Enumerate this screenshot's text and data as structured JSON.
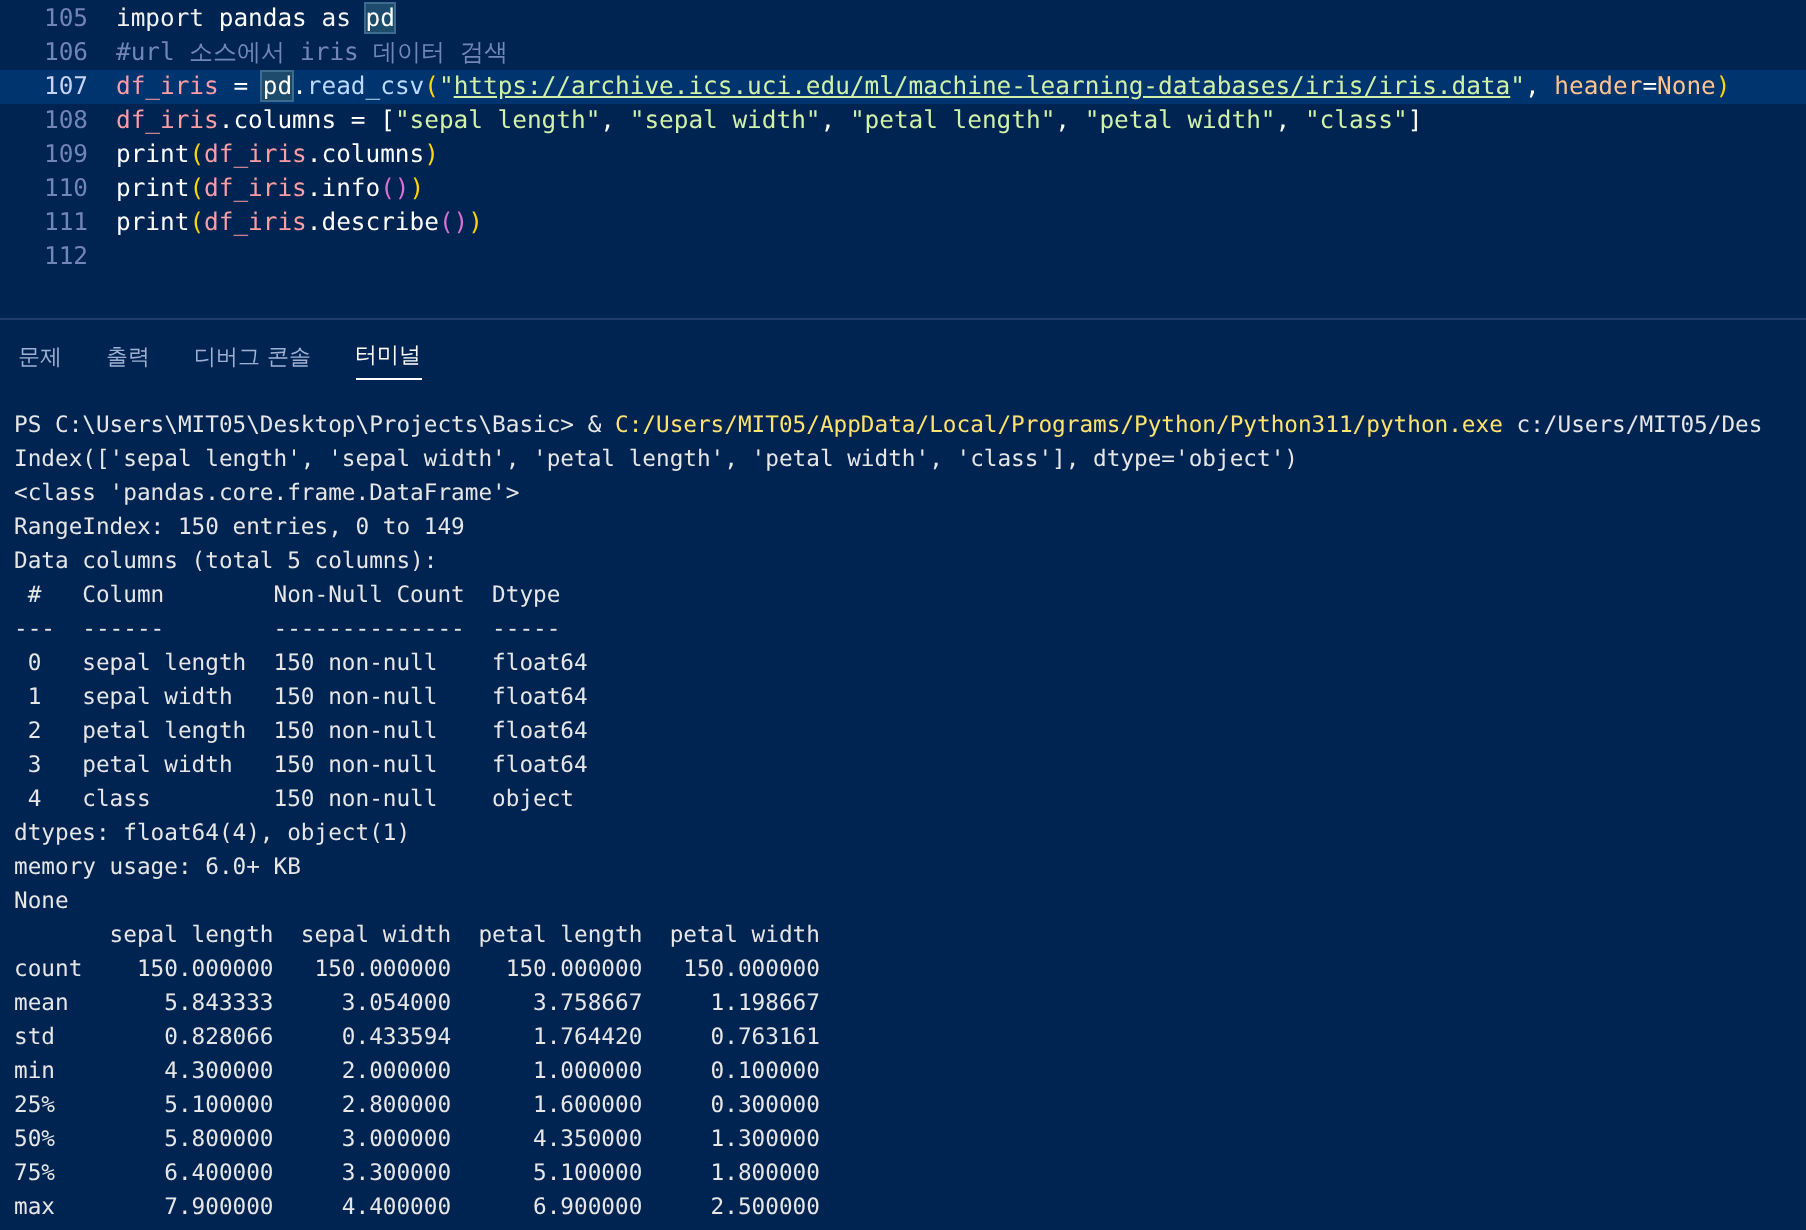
{
  "editor": {
    "lines": [
      {
        "number": "105",
        "active": false,
        "tokens": [
          {
            "text": "import",
            "kind": "keyword"
          },
          {
            "text": " pandas ",
            "kind": "plain"
          },
          {
            "text": "as ",
            "kind": "keyword"
          },
          {
            "text": "pd",
            "kind": "match"
          }
        ]
      },
      {
        "number": "106",
        "active": false,
        "tokens": [
          {
            "text": "#url 소스에서 iris 데이터 검색",
            "kind": "comment"
          }
        ]
      },
      {
        "number": "107",
        "active": true,
        "tokens": [
          {
            "text": "df_iris",
            "kind": "variable"
          },
          {
            "text": " = ",
            "kind": "plain"
          },
          {
            "text": "pd",
            "kind": "match"
          },
          {
            "text": ".",
            "kind": "plain"
          },
          {
            "text": "read_csv",
            "kind": "function"
          },
          {
            "text": "(",
            "kind": "paren"
          },
          {
            "text": "\"",
            "kind": "string"
          },
          {
            "text": "https://archive.ics.uci.edu/ml/machine-learning-databases/iris/iris.data",
            "kind": "link"
          },
          {
            "text": "\"",
            "kind": "string"
          },
          {
            "text": ", ",
            "kind": "plain"
          },
          {
            "text": "header",
            "kind": "param"
          },
          {
            "text": "=",
            "kind": "plain"
          },
          {
            "text": "None",
            "kind": "param"
          },
          {
            "text": ")",
            "kind": "paren"
          }
        ]
      },
      {
        "number": "108",
        "active": false,
        "tokens": [
          {
            "text": "df_iris",
            "kind": "variable"
          },
          {
            "text": ".columns = [",
            "kind": "plain"
          },
          {
            "text": "\"sepal length\"",
            "kind": "string"
          },
          {
            "text": ", ",
            "kind": "plain"
          },
          {
            "text": "\"sepal width\"",
            "kind": "string"
          },
          {
            "text": ", ",
            "kind": "plain"
          },
          {
            "text": "\"petal length\"",
            "kind": "string"
          },
          {
            "text": ", ",
            "kind": "plain"
          },
          {
            "text": "\"petal width\"",
            "kind": "string"
          },
          {
            "text": ", ",
            "kind": "plain"
          },
          {
            "text": "\"class\"",
            "kind": "string"
          },
          {
            "text": "]",
            "kind": "plain"
          }
        ]
      },
      {
        "number": "109",
        "active": false,
        "tokens": [
          {
            "text": "print",
            "kind": "plain"
          },
          {
            "text": "(",
            "kind": "paren"
          },
          {
            "text": "df_iris",
            "kind": "variable"
          },
          {
            "text": ".columns",
            "kind": "plain"
          },
          {
            "text": ")",
            "kind": "paren"
          }
        ]
      },
      {
        "number": "110",
        "active": false,
        "tokens": [
          {
            "text": "print",
            "kind": "plain"
          },
          {
            "text": "(",
            "kind": "paren"
          },
          {
            "text": "df_iris",
            "kind": "variable"
          },
          {
            "text": ".info",
            "kind": "plain"
          },
          {
            "text": "()",
            "kind": "paren2"
          },
          {
            "text": ")",
            "kind": "paren"
          }
        ]
      },
      {
        "number": "111",
        "active": false,
        "tokens": [
          {
            "text": "print",
            "kind": "plain"
          },
          {
            "text": "(",
            "kind": "paren"
          },
          {
            "text": "df_iris",
            "kind": "variable"
          },
          {
            "text": ".describe",
            "kind": "plain"
          },
          {
            "text": "()",
            "kind": "paren2"
          },
          {
            "text": ")",
            "kind": "paren"
          }
        ]
      },
      {
        "number": "112",
        "active": false
      }
    ]
  },
  "panel": {
    "tabs": [
      {
        "label": "문제",
        "selected": false
      },
      {
        "label": "출력",
        "selected": false
      },
      {
        "label": "디버그 콘솔",
        "selected": false
      },
      {
        "label": "터미널",
        "selected": true
      }
    ]
  },
  "terminal": {
    "prompt": "PS C:\\Users\\MIT05\\Desktop\\Projects\\Basic> ",
    "operator": "& ",
    "executable": "C:/Users/MIT05/AppData/Local/Programs/Python/Python311/python.exe",
    "argument": " c:/Users/MIT05/Des",
    "lines": [
      "Index(['sepal length', 'sepal width', 'petal length', 'petal width', 'class'], dtype='object')",
      "<class 'pandas.core.frame.DataFrame'>",
      "RangeIndex: 150 entries, 0 to 149",
      "Data columns (total 5 columns):",
      " #   Column        Non-Null Count  Dtype  ",
      "---  ------        --------------  -----  ",
      " 0   sepal length  150 non-null    float64",
      " 1   sepal width   150 non-null    float64",
      " 2   petal length  150 non-null    float64",
      " 3   petal width   150 non-null    float64",
      " 4   class         150 non-null    object ",
      "dtypes: float64(4), object(1)",
      "memory usage: 6.0+ KB",
      "None",
      "       sepal length  sepal width  petal length  petal width",
      "count    150.000000   150.000000    150.000000   150.000000",
      "mean       5.843333     3.054000      3.758667     1.198667",
      "std        0.828066     0.433594      1.764420     0.763161",
      "min        4.300000     2.000000      1.000000     0.100000",
      "25%        5.100000     2.800000      1.600000     0.300000",
      "50%        5.800000     3.000000      4.350000     1.300000",
      "75%        6.400000     3.300000      5.100000     1.800000",
      "max        7.900000     4.400000      6.900000     2.500000"
    ]
  }
}
